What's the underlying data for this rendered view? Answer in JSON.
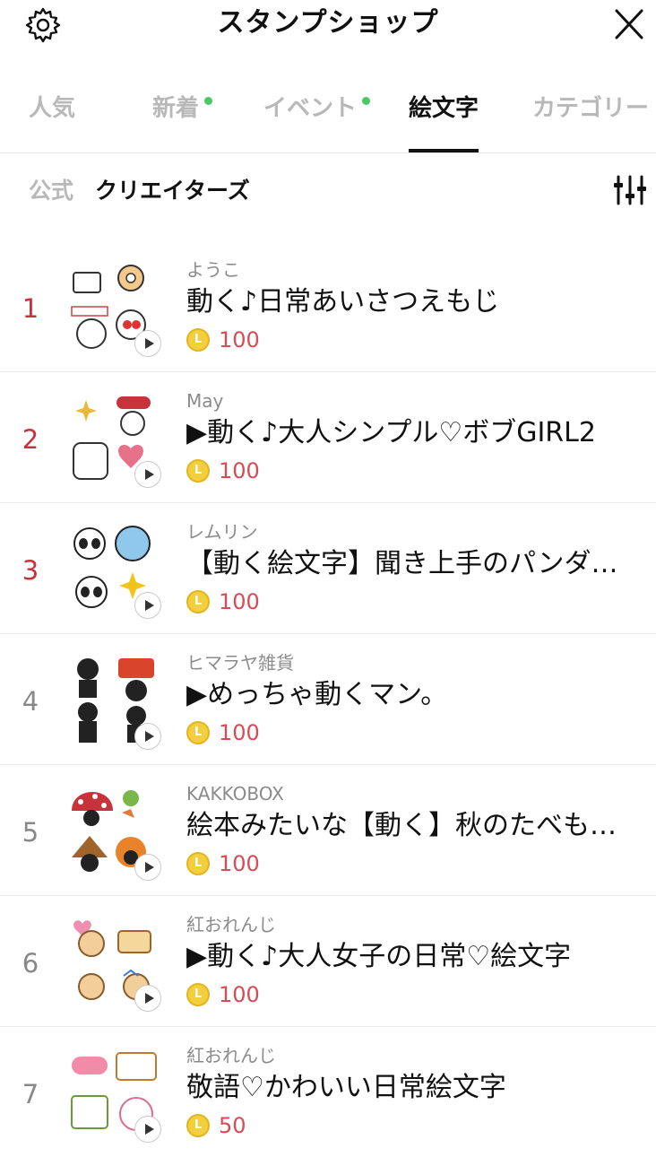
{
  "header": {
    "title": "スタンプショップ",
    "settings_icon": "gear-icon",
    "close_icon": "close-icon"
  },
  "tabs": [
    {
      "label": "人気",
      "active": false,
      "dot": false
    },
    {
      "label": "新着",
      "active": false,
      "dot": true
    },
    {
      "label": "イベント",
      "active": false,
      "dot": true
    },
    {
      "label": "絵文字",
      "active": true,
      "dot": false
    },
    {
      "label": "カテゴリー",
      "active": false,
      "dot": false
    }
  ],
  "filters": {
    "official": "公式",
    "creators": "クリエイターズ",
    "sort_icon": "sliders-icon"
  },
  "colors": {
    "rank_top": "#c8323b",
    "price": "#d94a55",
    "new_dot": "#4cc764",
    "coin": "#f3cf3d"
  },
  "items": [
    {
      "rank": "1",
      "author": "ようこ",
      "name": "動く♪日常あいさつえもじ",
      "price": "100"
    },
    {
      "rank": "2",
      "author": "May",
      "name": "▶動く♪大人シンプル♡ボブGIRL2",
      "price": "100"
    },
    {
      "rank": "3",
      "author": "レムリン",
      "name": "【動く絵文字】聞き上手のパンダ…",
      "price": "100"
    },
    {
      "rank": "4",
      "author": "ヒマラヤ雑貨",
      "name": "▶めっちゃ動くマン。",
      "price": "100"
    },
    {
      "rank": "5",
      "author": "KAKKOBOX",
      "name": "絵本みたいな【動く】秋のたべも…",
      "price": "100"
    },
    {
      "rank": "6",
      "author": "紅おれんじ",
      "name": "▶動く♪大人女子の日常♡絵文字",
      "price": "100"
    },
    {
      "rank": "7",
      "author": "紅おれんじ",
      "name": "敬語♡かわいい日常絵文字",
      "price": "50"
    }
  ],
  "coin_symbol": "L"
}
